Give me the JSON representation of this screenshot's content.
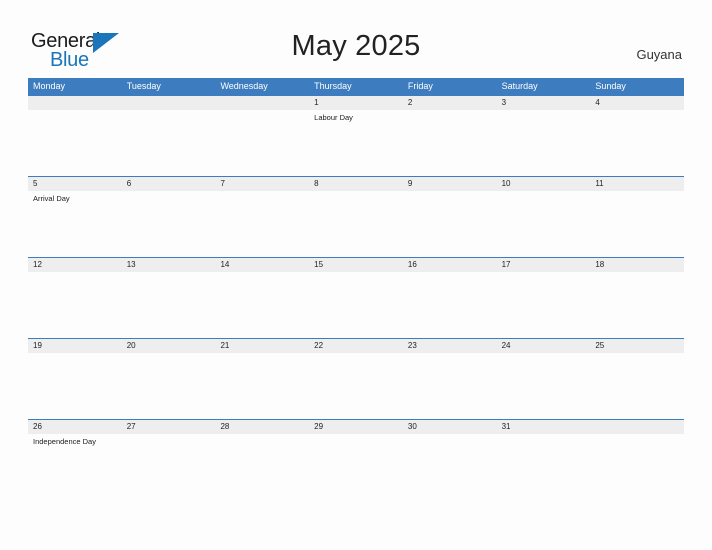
{
  "brand": {
    "name_part1": "General",
    "name_part2": "Blue",
    "triangle_color": "#1a75bb",
    "text_color": "#1b1b1b"
  },
  "header": {
    "title": "May 2025",
    "region": "Guyana"
  },
  "colors": {
    "header_blue": "#3d7cbe",
    "number_band_gray": "#eeeeee",
    "page_background": "#fdfdfd",
    "text_dark": "#222222"
  },
  "calendar": {
    "weekdays": [
      "Monday",
      "Tuesday",
      "Wednesday",
      "Thursday",
      "Friday",
      "Saturday",
      "Sunday"
    ],
    "weeks": [
      {
        "days": [
          {
            "number": "",
            "event": ""
          },
          {
            "number": "",
            "event": ""
          },
          {
            "number": "",
            "event": ""
          },
          {
            "number": "1",
            "event": "Labour Day"
          },
          {
            "number": "2",
            "event": ""
          },
          {
            "number": "3",
            "event": ""
          },
          {
            "number": "4",
            "event": ""
          }
        ]
      },
      {
        "days": [
          {
            "number": "5",
            "event": "Arrival Day"
          },
          {
            "number": "6",
            "event": ""
          },
          {
            "number": "7",
            "event": ""
          },
          {
            "number": "8",
            "event": ""
          },
          {
            "number": "9",
            "event": ""
          },
          {
            "number": "10",
            "event": ""
          },
          {
            "number": "11",
            "event": ""
          }
        ]
      },
      {
        "days": [
          {
            "number": "12",
            "event": ""
          },
          {
            "number": "13",
            "event": ""
          },
          {
            "number": "14",
            "event": ""
          },
          {
            "number": "15",
            "event": ""
          },
          {
            "number": "16",
            "event": ""
          },
          {
            "number": "17",
            "event": ""
          },
          {
            "number": "18",
            "event": ""
          }
        ]
      },
      {
        "days": [
          {
            "number": "19",
            "event": ""
          },
          {
            "number": "20",
            "event": ""
          },
          {
            "number": "21",
            "event": ""
          },
          {
            "number": "22",
            "event": ""
          },
          {
            "number": "23",
            "event": ""
          },
          {
            "number": "24",
            "event": ""
          },
          {
            "number": "25",
            "event": ""
          }
        ]
      },
      {
        "days": [
          {
            "number": "26",
            "event": "Independence Day"
          },
          {
            "number": "27",
            "event": ""
          },
          {
            "number": "28",
            "event": ""
          },
          {
            "number": "29",
            "event": ""
          },
          {
            "number": "30",
            "event": ""
          },
          {
            "number": "31",
            "event": ""
          },
          {
            "number": "",
            "event": ""
          }
        ]
      }
    ]
  }
}
